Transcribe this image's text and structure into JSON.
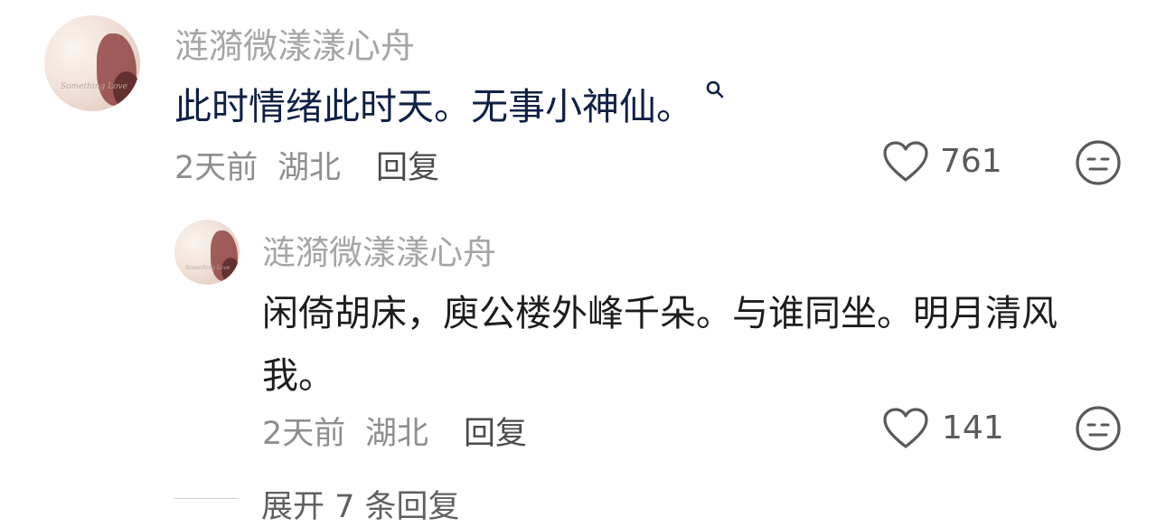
{
  "comment": {
    "username": "涟漪微漾漾心舟",
    "text": "此时情绪此时天。无事小神仙。",
    "time": "2天前",
    "location": "湖北",
    "reply_label": "回复",
    "like_count": "761",
    "icons": {
      "search": "search-icon",
      "like": "heart-icon",
      "reaction": "neutral-face-icon"
    }
  },
  "reply": {
    "username": "涟漪微漾漾心舟",
    "text_line1": "闲倚胡床，庾公楼外峰千朵。与谁同坐。明月清风",
    "text_line2": "我。",
    "time": "2天前",
    "location": "湖北",
    "reply_label": "回复",
    "like_count": "141"
  },
  "expand": {
    "label": "展开 7 条回复"
  },
  "colors": {
    "username": "#a5a5a5",
    "main_text": "#0f2044",
    "reply_text": "#1d1d1f",
    "meta": "#8e8e8e"
  }
}
